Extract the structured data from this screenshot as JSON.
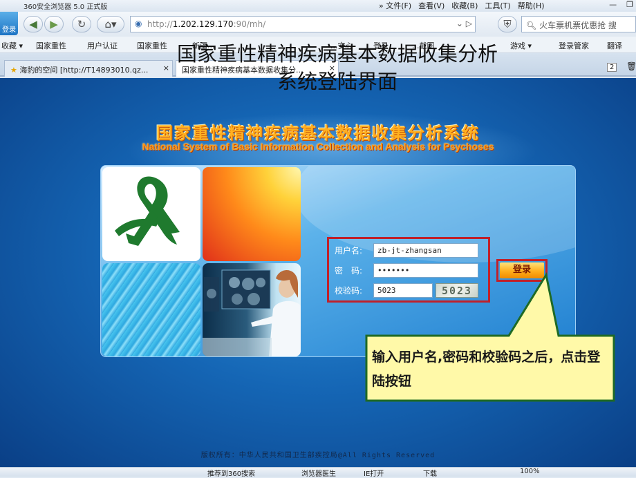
{
  "browser": {
    "app_title": "360安全浏览器 5.0 正式版",
    "menu": [
      "» 文件(F)",
      "查看(V)",
      "收藏(B)",
      "工具(T)",
      "帮助(H)"
    ],
    "login_badge": "登录",
    "url_prefix": "http://",
    "url_host": "1.202.129.170",
    "url_rest": ":90/mh/",
    "search_text": "火车票机票优惠抢",
    "search_button": "搜",
    "favorites": [
      "收藏 ▾",
      "国家重性",
      "用户认证",
      "国家重性",
      "新疆...",
      "...安心",
      "登录",
      "...截图",
      "游戏 ▾",
      "登录管家",
      "翻译"
    ],
    "tabs": [
      {
        "label": "海豹的空间 [http://T14893010.qz..."
      },
      {
        "label": "国家重性精神疾病基本数据收集分..."
      }
    ]
  },
  "slide_title": "国家重性精神疾病基本数据收集分析系统登陆界面",
  "page": {
    "system_title_cn": "国家重性精神疾病基本数据收集分析系统",
    "system_title_en": "National System of Basic Information Collection and Analysis for Psychoses",
    "form": {
      "username_label": "用户名:",
      "username_value": "zb-jt-zhangsan",
      "password_label": "密　码:",
      "password_value": "•••••••",
      "captcha_label": "校验码:",
      "captcha_value": "5023",
      "captcha_image_text": "5023",
      "login_button": "登录"
    },
    "footer": "版权所有：中华人民共和国卫生部疾控局@All Rights Reserved"
  },
  "callout": {
    "text": "输入用户名,密码和校验码之后，点击登陆按钮",
    "fill": "#fff9a8",
    "border": "#1f6a25"
  },
  "statusbar": {
    "items": [
      "推荐到360搜索",
      "浏览器医生",
      "IE打开",
      "下载",
      "100%"
    ]
  }
}
